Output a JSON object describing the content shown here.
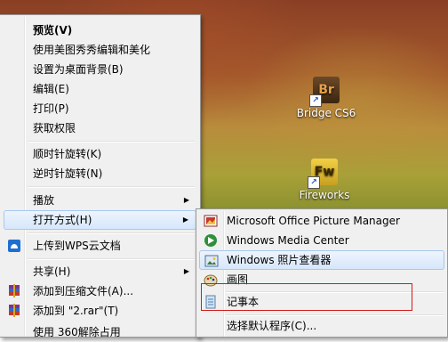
{
  "desktop": {
    "icons": [
      {
        "label": "Bridge CS6",
        "tile_text": "Br",
        "icon": "adobe-bridge-icon"
      },
      {
        "label": "Fireworks",
        "tile_text": "Fw",
        "icon": "adobe-fireworks-icon"
      }
    ]
  },
  "context_menu": {
    "items": [
      {
        "label": "预览(V)",
        "bold": true
      },
      {
        "label": "使用美图秀秀编辑和美化"
      },
      {
        "label": "设置为桌面背景(B)"
      },
      {
        "label": "编辑(E)"
      },
      {
        "label": "打印(P)"
      },
      {
        "label": "获取权限"
      },
      {
        "label": "顺时针旋转(K)"
      },
      {
        "label": "逆时针旋转(N)"
      },
      {
        "label": "播放",
        "submenu": true
      },
      {
        "label": "打开方式(H)",
        "submenu": true,
        "highlighted": true
      },
      {
        "label": "上传到WPS云文档",
        "icon": "wps-cloud-icon"
      },
      {
        "label": "共享(H)",
        "submenu": true
      },
      {
        "label": "添加到压缩文件(A)...",
        "icon": "winrar-icon"
      },
      {
        "label": "添加到 \"2.rar\"(T)",
        "icon": "winrar-icon"
      },
      {
        "label": "使用 360解除占用"
      }
    ]
  },
  "open_with_menu": {
    "items": [
      {
        "label": "Microsoft Office Picture Manager",
        "icon": "office-picture-manager-icon"
      },
      {
        "label": "Windows Media Center",
        "icon": "media-center-icon"
      },
      {
        "label": "Windows 照片查看器",
        "icon": "photo-viewer-icon",
        "highlighted": true
      },
      {
        "label": "画图",
        "icon": "paint-icon"
      },
      {
        "label": "记事本",
        "icon": "notepad-icon",
        "outlined": true
      },
      {
        "label": "选择默认程序(C)..."
      }
    ]
  },
  "colors": {
    "highlight_border": "#a8c8ee",
    "annotation_red": "#d21a1a"
  }
}
